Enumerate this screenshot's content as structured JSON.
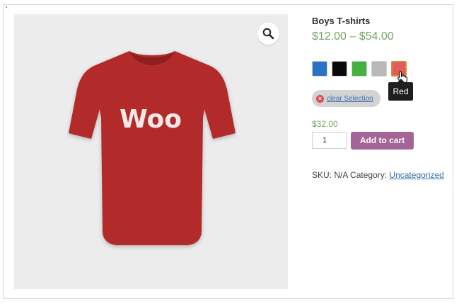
{
  "product": {
    "title": "Boys T-shirts",
    "price_range": "$12.00 – $54.00",
    "shirt_logo_text": "Woo",
    "shirt_color": "#b22a2a"
  },
  "swatches": [
    {
      "color": "#2a72c4",
      "name": "Blue"
    },
    {
      "color": "#0a0a0a",
      "name": "Black"
    },
    {
      "color": "#45b13f",
      "name": "Green"
    },
    {
      "color": "#b9b9b9",
      "name": "Gray"
    },
    {
      "color": "#e25a5a",
      "name": "Red",
      "selected": true
    }
  ],
  "tooltip": {
    "text": "Red"
  },
  "clear_selection": {
    "label": "clear Selection"
  },
  "variation_price": "$32.00",
  "quantity": {
    "value": "1"
  },
  "add_to_cart": {
    "label": "Add to cart"
  },
  "meta": {
    "sku_label": "SKU:",
    "sku_value": "N/A",
    "category_label": "Category:",
    "category_value": "Uncategorized"
  },
  "icons": {
    "zoom": "magnifier-icon",
    "clear": "close-icon",
    "cursor": "hand-pointer-icon"
  },
  "colors": {
    "price": "#77a464",
    "button": "#a46497",
    "link": "#2f6fa8"
  }
}
